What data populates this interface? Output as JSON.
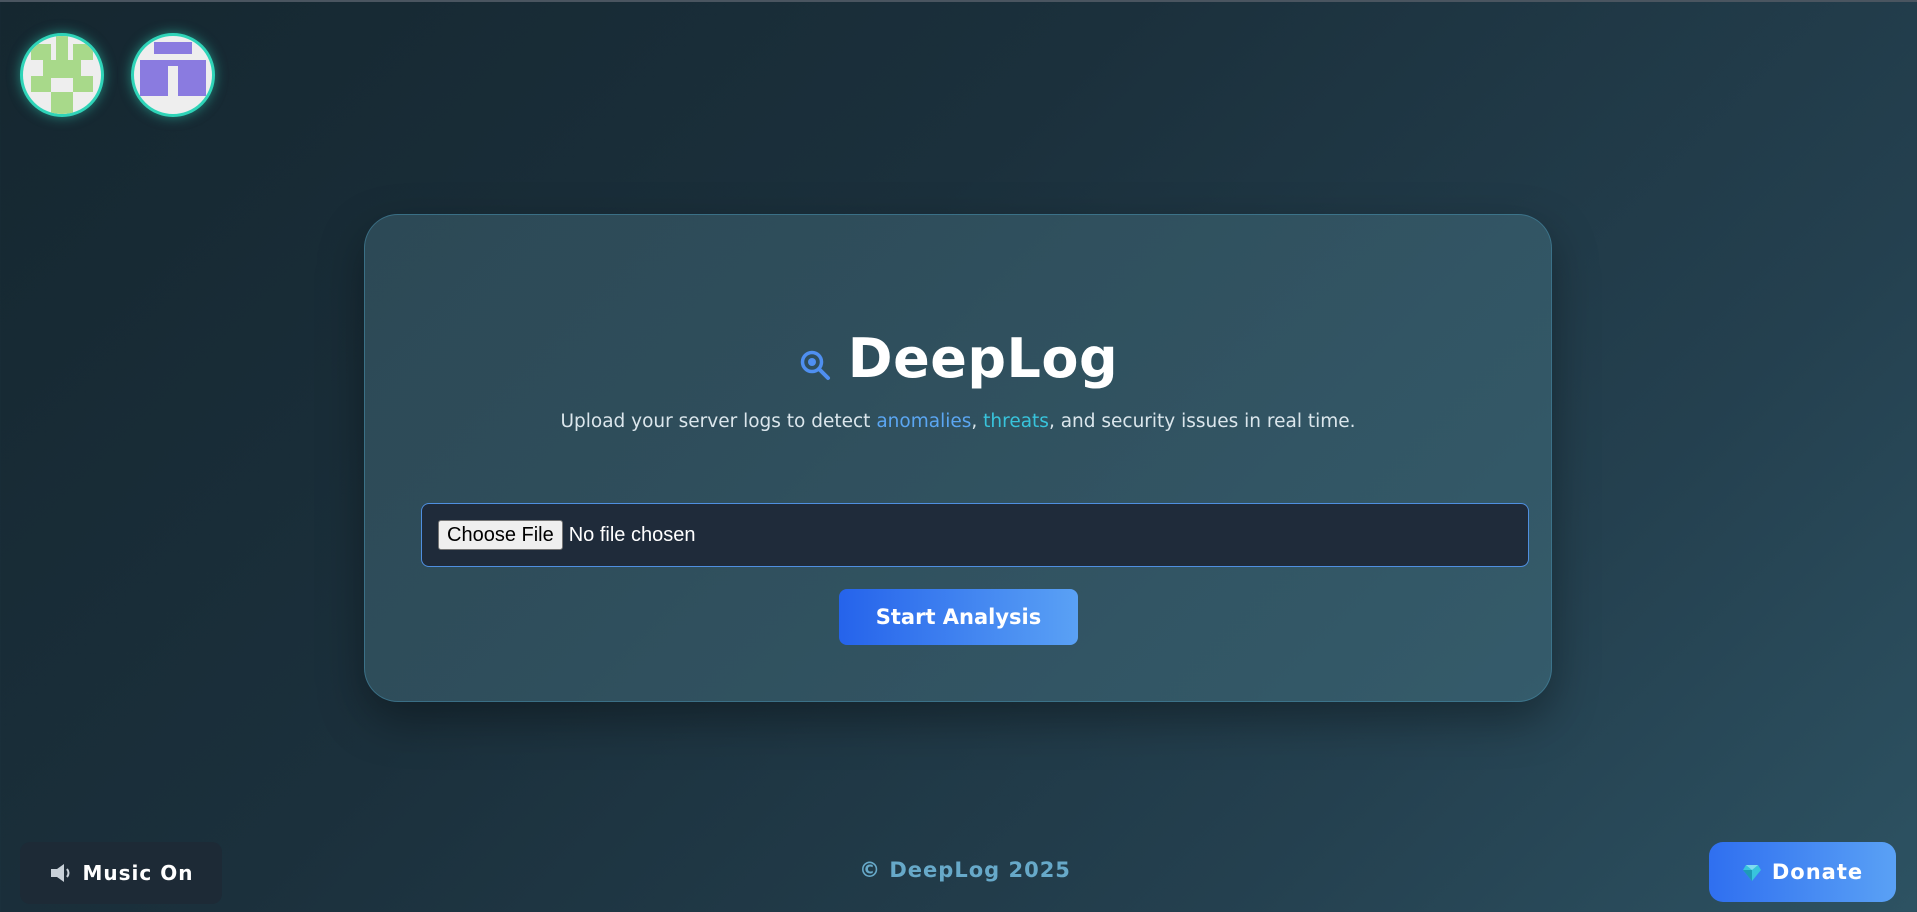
{
  "app": {
    "title": "DeepLog",
    "subtitle_start": "Upload your server logs to detect ",
    "highlight_1": "anomalies",
    "sep_1": ", ",
    "highlight_2": "threats",
    "subtitle_end": ", and security issues in real time.",
    "search_icon": "magnifier-icon"
  },
  "upload": {
    "choose_label": "Choose File",
    "status": "No file chosen"
  },
  "actions": {
    "start_label": "Start Analysis",
    "music_label": "Music On",
    "music_icon": "speaker-icon",
    "donate_label": "Donate",
    "donate_icon": "gem-icon"
  },
  "footer": {
    "text": "© DeepLog 2025"
  },
  "colors": {
    "accent": "#2563eb",
    "highlight_anomalies": "#5ba6f2",
    "highlight_threats": "#38c4dc",
    "avatar_ring": "#2fd4b8",
    "avatar_1_fill": "#a8d98a",
    "avatar_2_fill": "#8a7be0"
  }
}
